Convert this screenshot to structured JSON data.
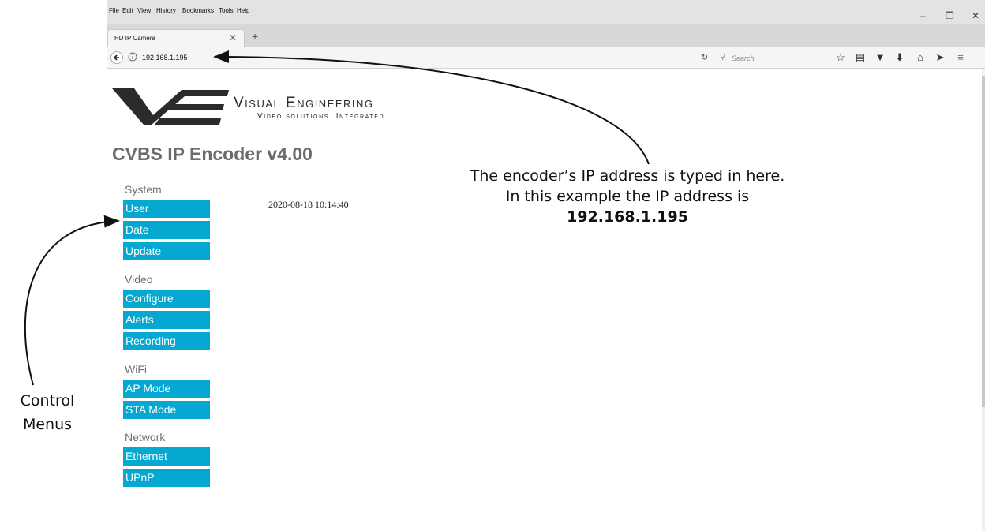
{
  "browser": {
    "menu": [
      "File",
      "Edit",
      "View",
      "History",
      "Bookmarks",
      "Tools",
      "Help"
    ],
    "tab_title": "HD IP Camera",
    "url": "192.168.1.195",
    "search_placeholder": "Search",
    "icons": [
      "back-icon",
      "info-icon",
      "reload-icon",
      "search-icon",
      "bookmark-star-icon",
      "reader-icon",
      "pocket-icon",
      "download-icon",
      "home-icon",
      "send-icon",
      "menu-icon"
    ]
  },
  "page": {
    "brand_name": "Visual Engineering",
    "brand_tagline": "Video solutions. Integrated.",
    "title": "CVBS IP Encoder v4.00",
    "datetime": "2020-08-18 10:14:40",
    "sections": [
      {
        "label": "System",
        "items": [
          "User",
          "Date",
          "Update"
        ]
      },
      {
        "label": "Video",
        "items": [
          "Configure",
          "Alerts",
          "Recording"
        ]
      },
      {
        "label": "WiFi",
        "items": [
          "AP Mode",
          "STA Mode"
        ]
      },
      {
        "label": "Network",
        "items": [
          "Ethernet",
          "UPnP"
        ]
      }
    ],
    "accent_color": "#05a8d0"
  },
  "annotations": {
    "ip_line1": "The encoder’s IP address is typed in here.",
    "ip_line2": "In this example the IP address is",
    "ip_value": "192.168.1.195",
    "menus_line1": "Control",
    "menus_line2": "Menus"
  }
}
